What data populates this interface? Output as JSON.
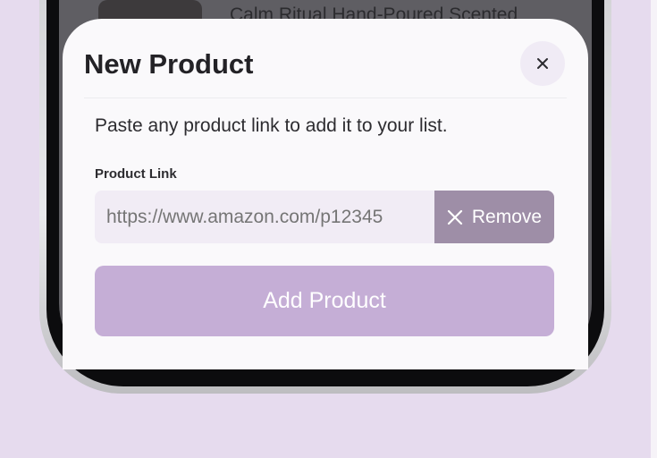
{
  "background_item": {
    "title": "Calm Ritual Hand-Poured Scented"
  },
  "modal": {
    "title": "New Product",
    "close_icon": "close-icon",
    "description": "Paste any product link to add it to your list.",
    "field_label": "Product Link",
    "link_placeholder": "https://www.amazon.com/p12345",
    "remove_label": "Remove",
    "add_button_label": "Add Product"
  },
  "colors": {
    "page_background": "#e6dbee",
    "sheet_background": "#faf9fb",
    "remove_button": "#9e8ea7",
    "add_button": "#c5aed6",
    "input_background": "#f1ecf5"
  }
}
